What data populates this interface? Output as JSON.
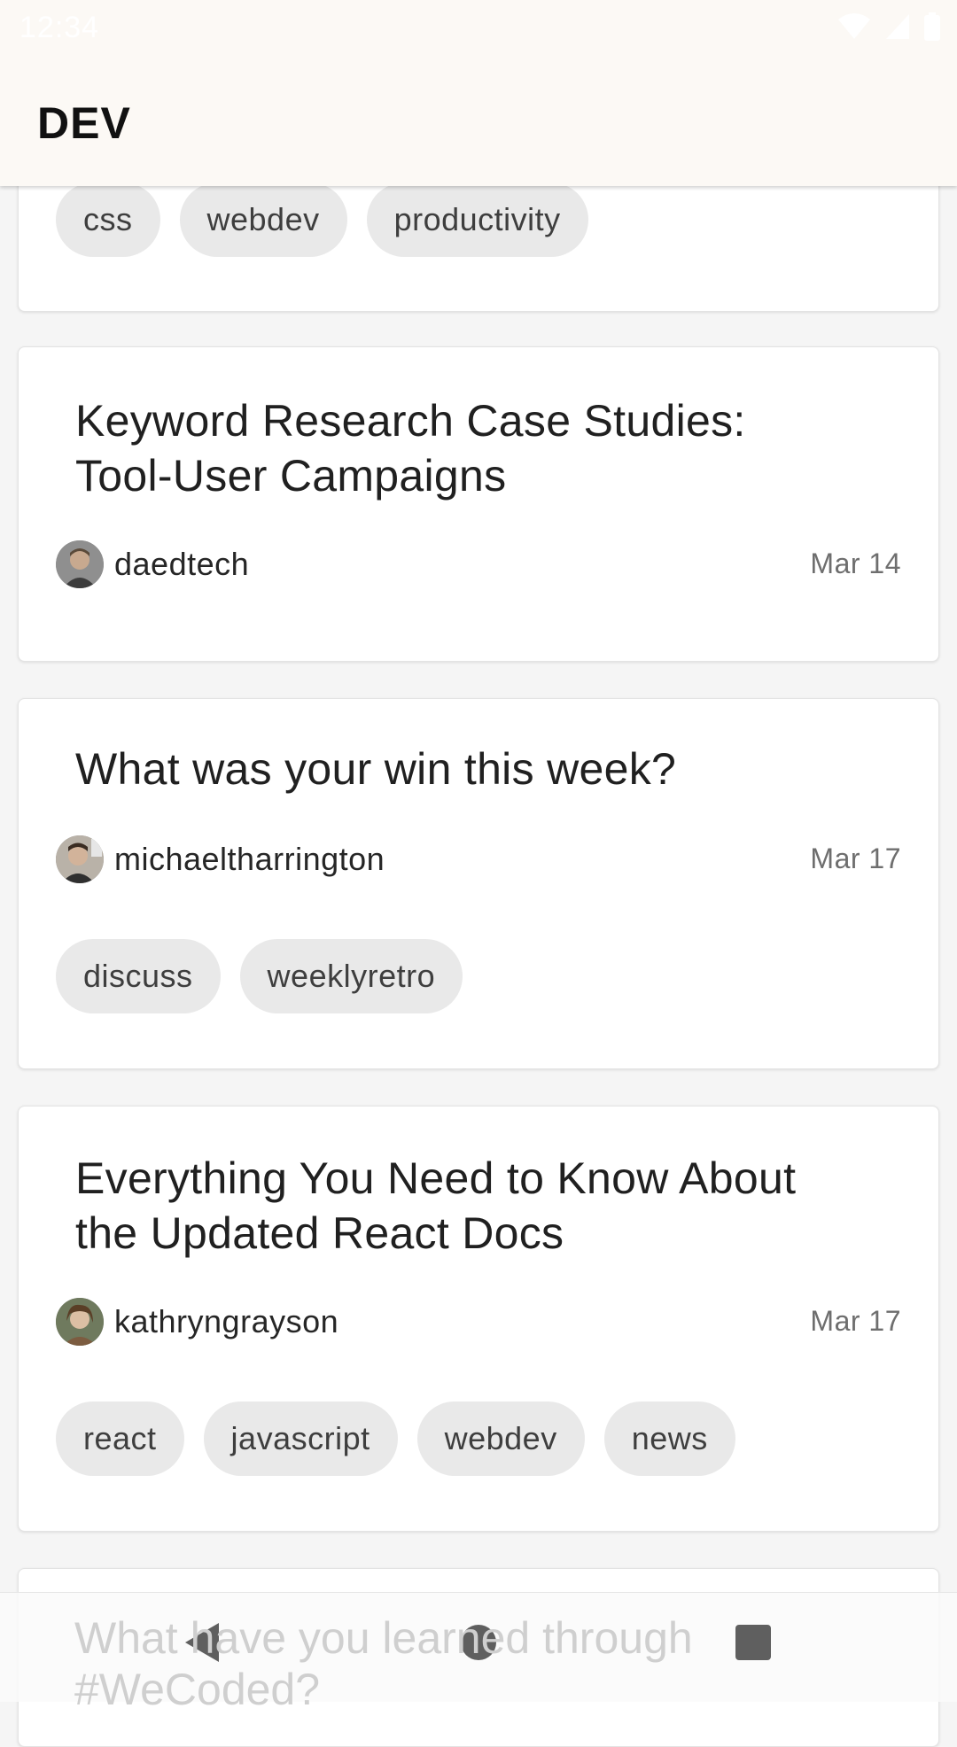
{
  "status_bar": {
    "time": "12:34"
  },
  "app_bar": {
    "title": "DEV"
  },
  "feed": {
    "partial_card": {
      "tags": [
        "css",
        "webdev",
        "productivity"
      ]
    },
    "articles": [
      {
        "title_line1": "Keyword Research Case Studies:",
        "title_line2": "Tool-User Campaigns",
        "author": "daedtech",
        "date": "Mar 14",
        "tags": []
      },
      {
        "title_line1": "What was your win this week?",
        "title_line2": "",
        "author": "michaeltharrington",
        "date": "Mar 17",
        "tags": [
          "discuss",
          "weeklyretro"
        ]
      },
      {
        "title_line1": "Everything You Need to Know About",
        "title_line2": "the Updated React Docs",
        "author": "kathryngrayson",
        "date": "Mar 17",
        "tags": [
          "react",
          "javascript",
          "webdev",
          "news"
        ]
      }
    ],
    "next_article": {
      "title_line1": "What have you learned through",
      "title_line2": "#WeCoded?"
    }
  },
  "nav_bar": {
    "icons": [
      "back-icon",
      "home-icon",
      "recents-icon"
    ]
  }
}
